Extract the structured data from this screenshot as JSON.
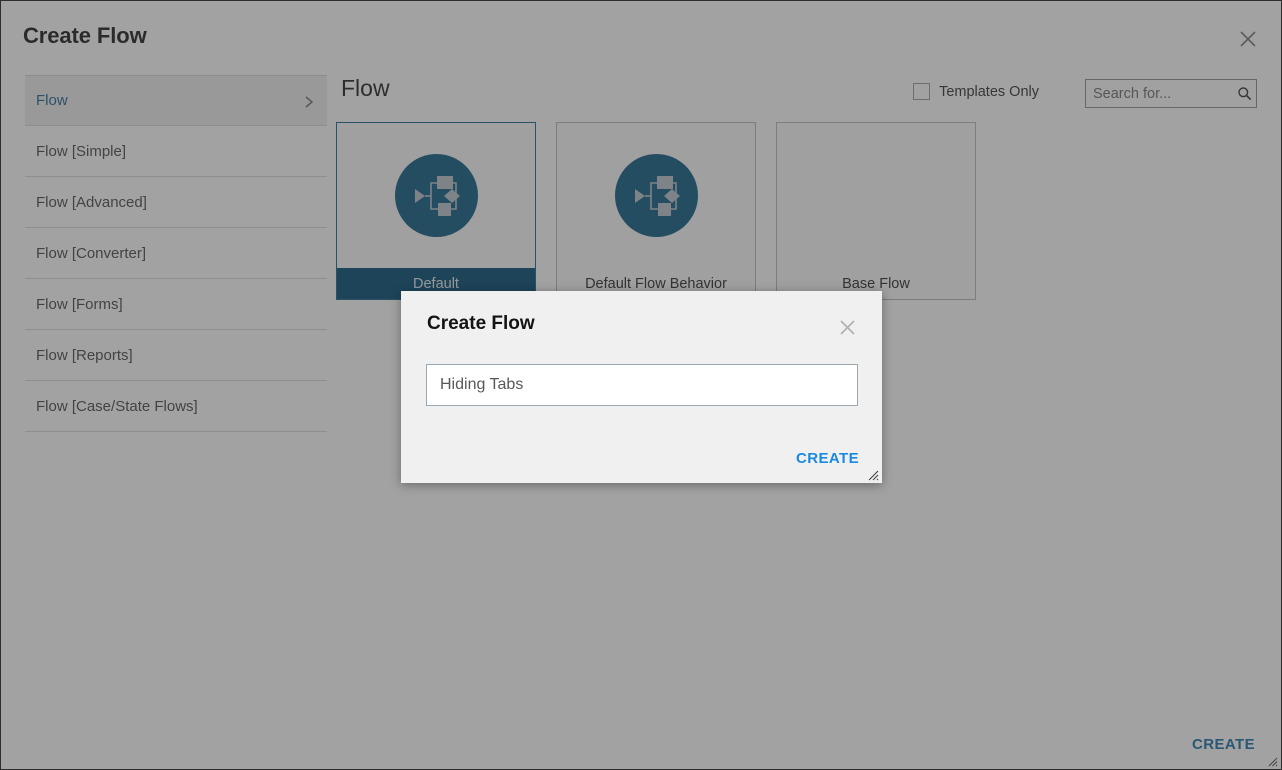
{
  "window": {
    "title": "Create Flow",
    "close_icon": "close-icon",
    "footer_create_label": "CREATE",
    "resize_handle_icon": "resize-handle-icon"
  },
  "sidebar": {
    "items": [
      {
        "label": "Flow",
        "selected": true,
        "chevron_icon": "chevron-right-icon"
      },
      {
        "label": "Flow [Simple]",
        "selected": false
      },
      {
        "label": "Flow [Advanced]",
        "selected": false
      },
      {
        "label": "Flow [Converter]",
        "selected": false
      },
      {
        "label": "Flow [Forms]",
        "selected": false
      },
      {
        "label": "Flow [Reports]",
        "selected": false
      },
      {
        "label": "Flow [Case/State Flows]",
        "selected": false
      }
    ]
  },
  "panel": {
    "title": "Flow",
    "templates_only": {
      "label": "Templates Only",
      "checked": false
    },
    "search": {
      "value": "",
      "placeholder": "Search for...",
      "icon": "search-icon"
    }
  },
  "cards": [
    {
      "label": "Default",
      "selected": true,
      "icon": "flow-diagram-icon"
    },
    {
      "label": "Default Flow Behavior",
      "selected": false,
      "icon": "flow-diagram-icon"
    },
    {
      "label": "Base Flow",
      "selected": false,
      "icon": "flow-thumbnail-preview"
    }
  ],
  "dialog": {
    "title": "Create Flow",
    "close_icon": "close-icon",
    "input": {
      "value": "Hiding Tabs",
      "placeholder": ""
    },
    "create_label": "CREATE",
    "resize_handle_icon": "resize-handle-icon"
  },
  "colors": {
    "accent_blue": "#0f5c85",
    "selected_footer": "#014b73",
    "link_blue": "#1a8ae0",
    "outer_link_blue": "#1b6fa8",
    "pin_start_green": "#1f7a1f",
    "pin_end_red": "#b02020",
    "backdrop": "rgba(60,60,60,0.48)"
  }
}
